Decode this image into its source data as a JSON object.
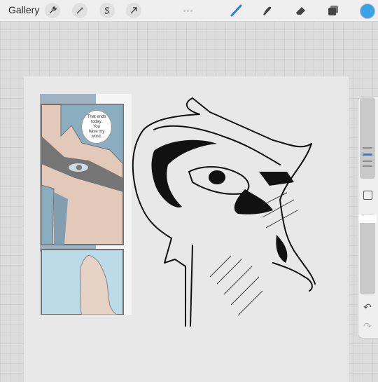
{
  "toolbar": {
    "gallery_label": "Gallery",
    "left_tools": [
      {
        "name": "wrench-icon",
        "glyph": "🔧"
      },
      {
        "name": "magic-wand-icon",
        "glyph": "✦"
      },
      {
        "name": "selection-icon",
        "glyph": "S"
      },
      {
        "name": "transform-arrow-icon",
        "glyph": "➚"
      }
    ],
    "right_tools": [
      "brush-icon",
      "smudge-icon",
      "eraser-icon",
      "layers-icon"
    ],
    "active_color": "#3aa2e6",
    "active_tool_color": "#2f7fe0"
  },
  "reference": {
    "bubble_lines": [
      "That ends",
      "today.",
      "You",
      "have my",
      "word."
    ]
  },
  "sidebar": {
    "brush_size_level": 0.27,
    "opacity_level": 0.05,
    "undo_icon": "↶",
    "redo_icon": "↷"
  }
}
